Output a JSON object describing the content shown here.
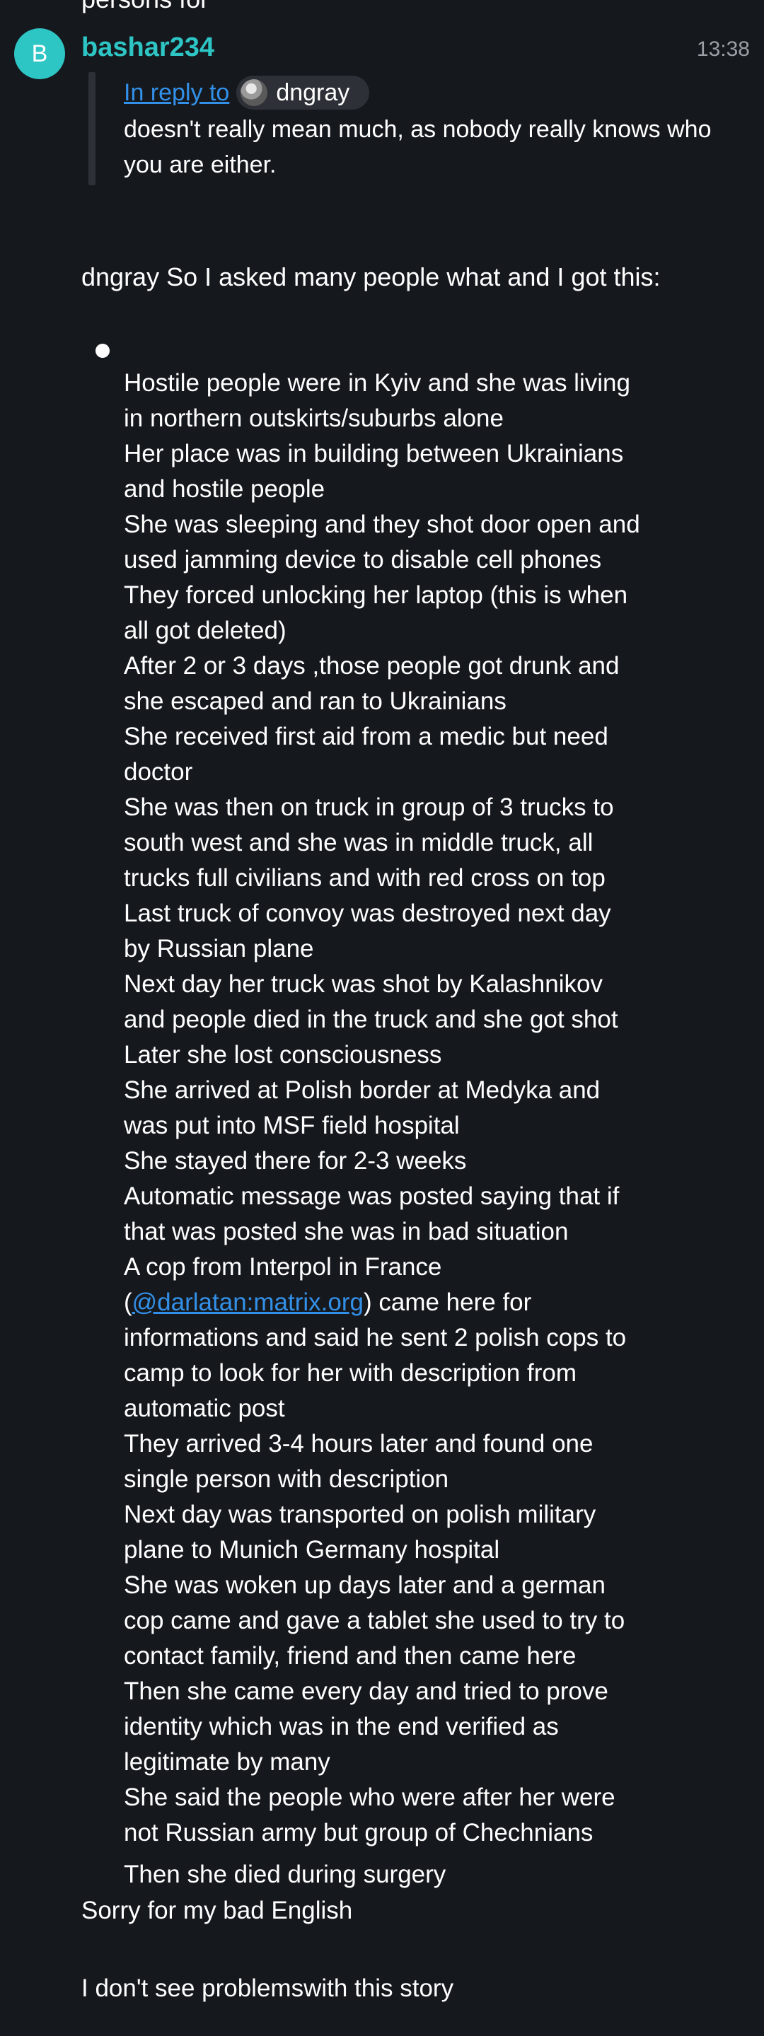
{
  "top_partial_text": "persons for",
  "message": {
    "avatar_letter": "B",
    "sender": "bashar234",
    "time": "13:38",
    "reply": {
      "link_text": "In reply to",
      "user": "dngray",
      "text": "doesn't really mean much, as nobody really knows who you are either."
    },
    "intro": "dngray So I asked many people what and I got this:",
    "story_items": [
      "Hostile people were in Kyiv and she was living in northern outskirts/suburbs alone",
      "Her place was in building between Ukrainians and hostile people",
      "She was sleeping and they shot door open and used jamming device to disable cell phones",
      "They forced unlocking her laptop (this is when all got deleted)",
      "After 2 or 3 days ,those people got drunk and she escaped and ran to Ukrainians",
      "She received first aid from a medic but need doctor",
      "She was then on truck in group of 3 trucks to south west and she was in middle truck, all trucks full civilians and with red cross on top",
      "Last truck of convoy was destroyed next day by Russian plane",
      "Next day her truck was shot by Kalashnikov and people died in the truck and she got shot",
      "Later she lost consciousness",
      "She arrived at Polish border at Medyka and was put into MSF field hospital",
      "She stayed there for 2-3 weeks",
      "Automatic message was posted saying that if that was posted she was in bad situation"
    ],
    "interpol_item": {
      "before": "A cop from Interpol in France (",
      "link": "@darlatan:matrix.org",
      "after": ") came here for informations and said he sent 2 polish cops to camp to look for her with description from automatic post"
    },
    "story_items_2": [
      "They arrived 3-4 hours later and found one single person with description",
      "Next day was transported on polish military plane to Munich Germany hospital",
      "She was woken up days later and a german cop came and gave a tablet she used to try to contact family, friend and then came here",
      "Then she came every day and tried to prove identity which was in the end verified as legitimate by many",
      "She said the people who were after her were not Russian army but group of Chechnians"
    ],
    "died": "Then she died during surgery",
    "sorry": "Sorry for my bad English",
    "followup": "I don't see problemswith this story"
  },
  "colors": {
    "background": "#15191e",
    "accent": "#2ec5c5",
    "link": "#3390e8",
    "muted": "#9aa0a6",
    "pill": "#2d3137"
  }
}
